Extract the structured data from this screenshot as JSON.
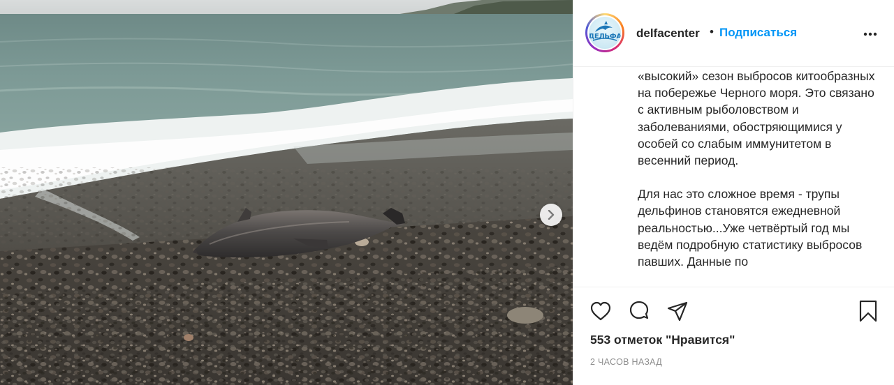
{
  "photo": {
    "alt_icon": "next-slide-chevron-icon"
  },
  "header": {
    "avatar_text": "ДЕЛЬФА",
    "username": "delfacenter",
    "separator": "•",
    "follow_label": "Подписаться",
    "more_icon": "more-options-icon"
  },
  "caption": {
    "paragraphs": [
      "«высокий» сезон выбросов китообразных на побережье Черного моря. Это связано с активным рыболовством и заболеваниями, обостряющимися у особей со слабым иммунитетом в весенний период.",
      "Для нас это сложное время - трупы дельфинов становятся ежедневной реальностью...Уже четвёртый год мы ведём подробную статистику выбросов павших. Данные по"
    ]
  },
  "actions": {
    "icons": [
      "heart-icon",
      "comment-icon",
      "share-icon",
      "bookmark-icon"
    ],
    "likes_text": "553 отметок \"Нравится\"",
    "time_text": "2 ЧАСОВ НАЗАД"
  },
  "colors": {
    "link": "#0095f6",
    "text": "#262626",
    "muted": "#8e8e8e",
    "border": "#efefef"
  }
}
